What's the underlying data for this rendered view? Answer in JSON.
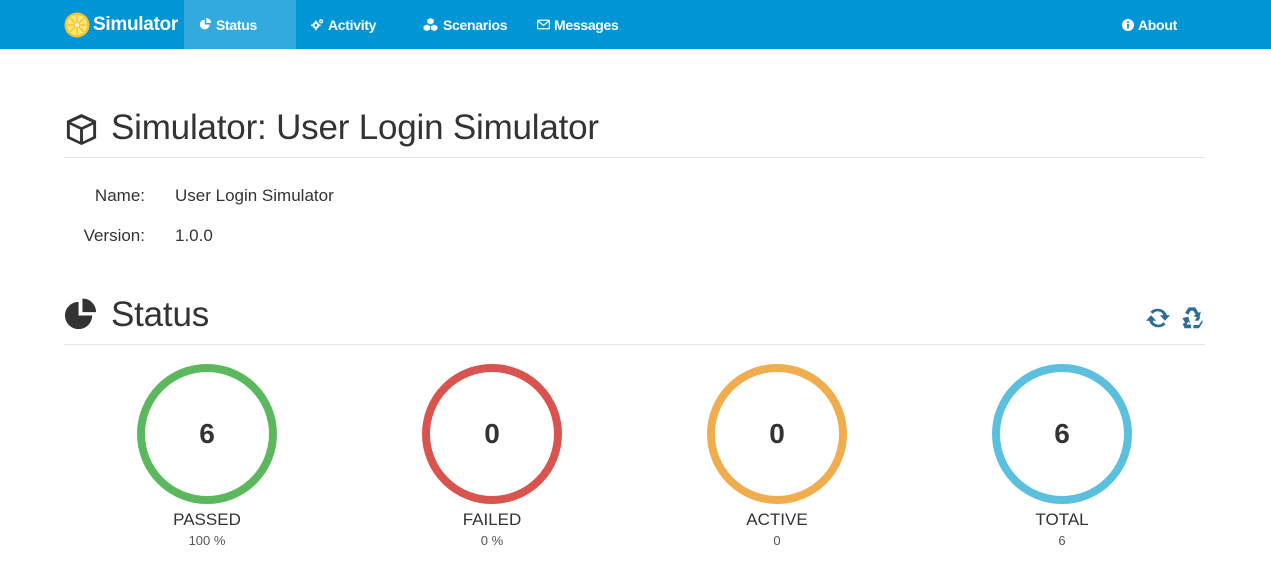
{
  "navbar": {
    "brand": "Simulator",
    "items": [
      {
        "label": "Status",
        "icon": "pie-chart-icon",
        "active": true
      },
      {
        "label": "Activity",
        "icon": "cogs-icon",
        "active": false
      },
      {
        "label": "Scenarios",
        "icon": "cubes-icon",
        "active": false
      },
      {
        "label": "Messages",
        "icon": "envelope-icon",
        "active": false
      }
    ],
    "about": {
      "label": "About",
      "icon": "info-circle-icon"
    }
  },
  "simulator": {
    "title": "Simulator: User Login Simulator",
    "icon": "cube-icon",
    "details": [
      {
        "label": "Name:",
        "value": "User Login Simulator"
      },
      {
        "label": "Version:",
        "value": "1.0.0"
      }
    ]
  },
  "status": {
    "title": "Status",
    "icon": "pie-chart-icon",
    "tools": [
      {
        "name": "refresh",
        "icon": "refresh-icon"
      },
      {
        "name": "reset",
        "icon": "recycle-icon"
      }
    ],
    "gauges": [
      {
        "label": "PASSED",
        "count": "6",
        "sub": "100 %",
        "color": "#5cb85c"
      },
      {
        "label": "FAILED",
        "count": "0",
        "sub": "0 %",
        "color": "#d9534f"
      },
      {
        "label": "ACTIVE",
        "count": "0",
        "sub": "0",
        "color": "#f0ad4e"
      },
      {
        "label": "TOTAL",
        "count": "6",
        "sub": "6",
        "color": "#5bc0de"
      }
    ]
  },
  "colors": {
    "navbar": "#0095d5",
    "navbar_active": "#33aadd",
    "tool_icons": "#2c6e96"
  }
}
